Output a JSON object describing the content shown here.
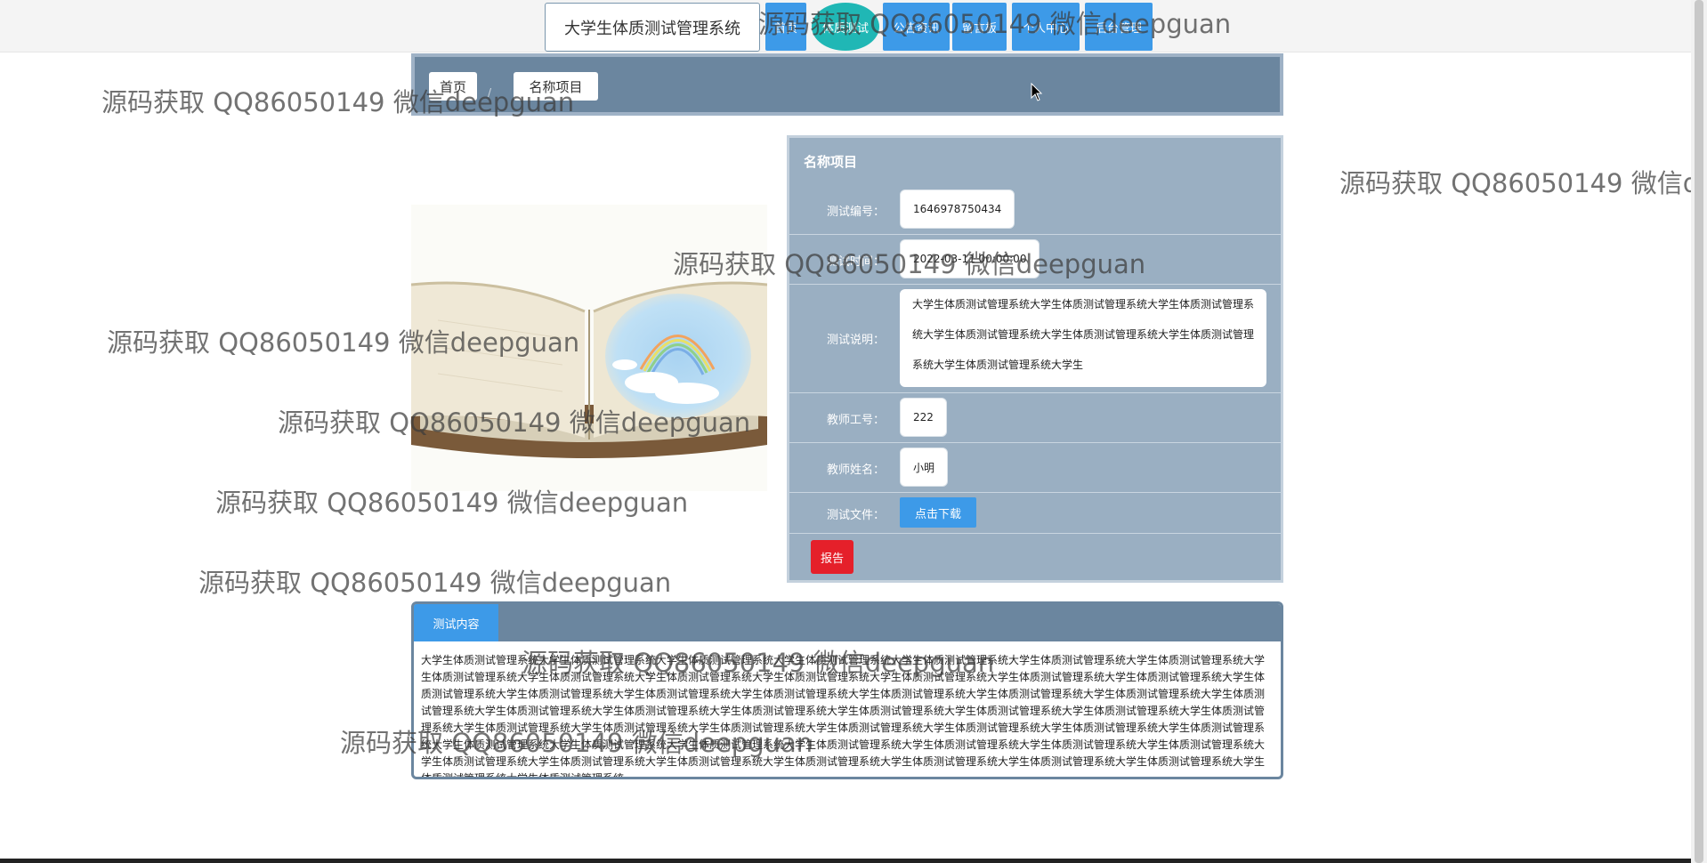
{
  "brand": {
    "title": "大学生体质测试管理系统"
  },
  "nav": {
    "items": [
      {
        "label": "首页"
      },
      {
        "label": "体质测试"
      },
      {
        "label": "公告资讯"
      },
      {
        "label": "留言板"
      },
      {
        "label": "个人中心"
      },
      {
        "label": "后台管理"
      }
    ]
  },
  "breadcrumb": {
    "home": "首页",
    "separator": "/",
    "current": "名称项目"
  },
  "detail": {
    "title": "名称项目",
    "fields": {
      "test_no": {
        "label": "测试编号：",
        "value": "1646978750434"
      },
      "test_time": {
        "label": "测试时间：",
        "value": "2022-03-11 00:00:00"
      },
      "test_desc": {
        "label": "测试说明：",
        "value": "大学生体质测试管理系统大学生体质测试管理系统大学生体质测试管理系统大学生体质测试管理系统大学生体质测试管理系统大学生体质测试管理系统大学生体质测试管理系统大学生"
      },
      "teacher_no": {
        "label": "教师工号：",
        "value": "222"
      },
      "teacher_name": {
        "label": "教师姓名：",
        "value": "小明"
      },
      "test_file": {
        "label": "测试文件：",
        "button": "点击下载"
      }
    },
    "report_button": "报告"
  },
  "content": {
    "tab": "测试内容",
    "text": "大学生体质测试管理系统大学生体质测试管理系统大学生体质测试管理系统大学生体质测试管理系统大学生体质测试管理系统大学生体质测试管理系统大学生体质测试管理系统大学生体质测试管理系统大学生体质测试管理系统大学生体质测试管理系统大学生体质测试管理系统大学生体质测试管理系统大学生体质测试管理系统大学生体质测试管理系统大学生体质测试管理系统大学生体质测试管理系统大学生体质测试管理系统大学生体质测试管理系统大学生体质测试管理系统大学生体质测试管理系统大学生体质测试管理系统大学生体质测试管理系统大学生体质测试管理系统大学生体质测试管理系统大学生体质测试管理系统大学生体质测试管理系统大学生体质测试管理系统大学生体质测试管理系统大学生体质测试管理系统大学生体质测试管理系统大学生体质测试管理系统大学生体质测试管理系统大学生体质测试管理系统大学生体质测试管理系统大学生体质测试管理系统大学生体质测试管理系统大学生体质测试管理系统大学生体质测试管理系统大学生体质测试管理系统大学生体质测试管理系统大学生体质测试管理系统大学生体质测试管理系统大学生体质测试管理系统大学生体质测试管理系统大学生体质测试管理系统大学生体质测试管理系统大学生体质测试管理系统大学生体质测试管理系统大学生体质测试管理系统大学生体质测试管理系统大学生体质测试管理系统大学生体质测试管理系统"
  },
  "watermark": {
    "text": "源码获取 QQ86050149 微信deepguan"
  },
  "colors": {
    "nav_blue": "#3d9ae8",
    "nav_active_teal": "#20b7b5",
    "panel_slate": "#6b869f",
    "detail_bg": "#9aafc2",
    "report_red": "#e5202a"
  }
}
